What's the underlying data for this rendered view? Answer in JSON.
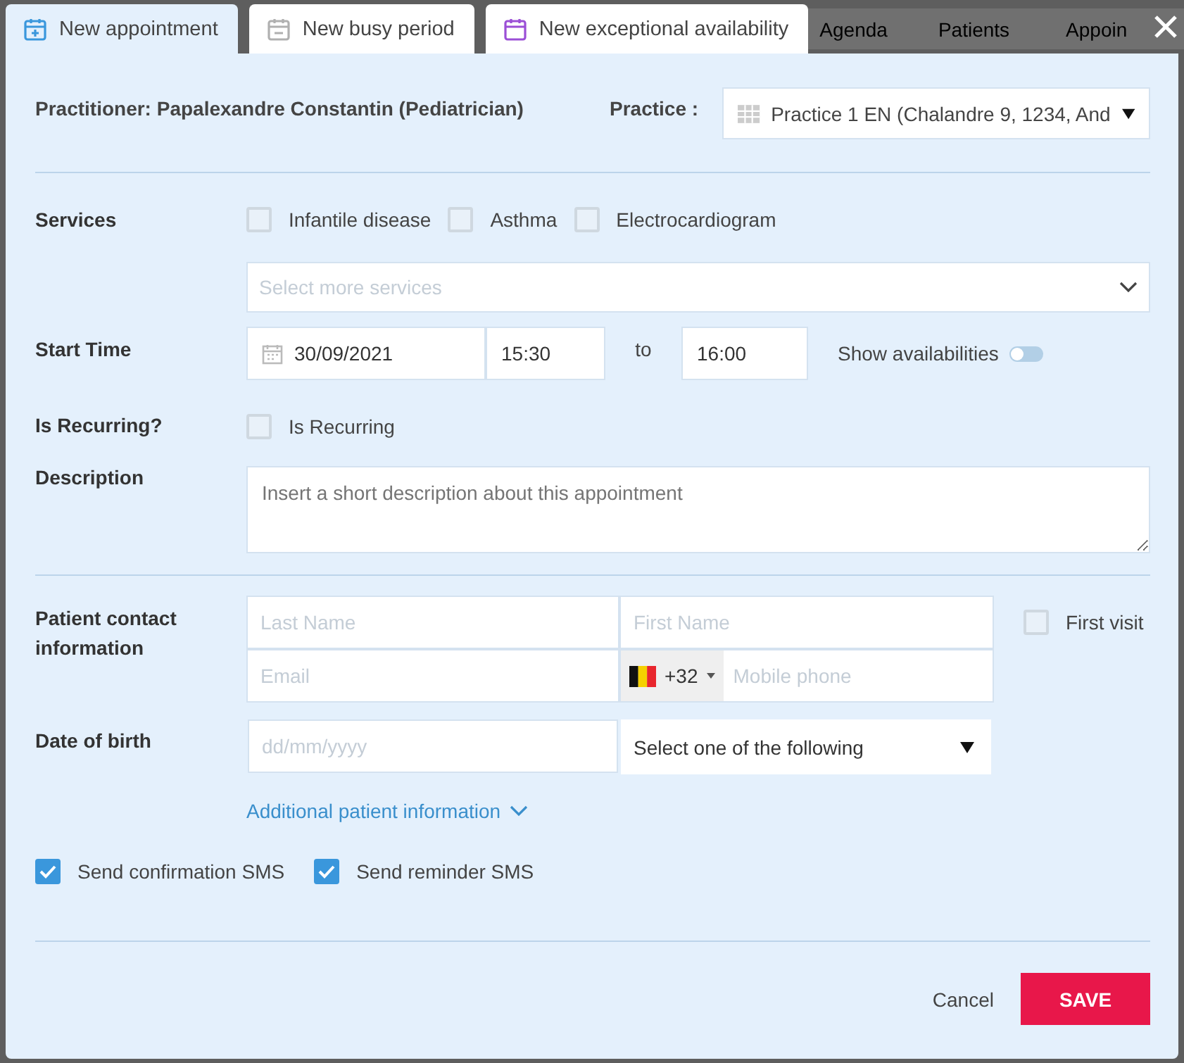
{
  "dialog_tabs": [
    {
      "label": "New appointment",
      "kind": "appointment",
      "selected": true
    },
    {
      "label": "New busy period",
      "kind": "busy",
      "selected": false
    },
    {
      "label": "New exceptional availability",
      "kind": "availability",
      "selected": false
    }
  ],
  "background_tabs": [
    "Agenda",
    "Patients",
    "Appoin"
  ],
  "practitioner": "Practitioner: Papalexandre Constantin (Pediatrician)",
  "practice": {
    "label": "Practice :",
    "value": "Practice 1 EN (Chalandre 9, 1234, And"
  },
  "services": {
    "label": "Services",
    "options": [
      {
        "label": "Infantile disease",
        "checked": false
      },
      {
        "label": "Asthma",
        "checked": false
      },
      {
        "label": "Electrocardiogram",
        "checked": false
      }
    ],
    "more_placeholder": "Select more services"
  },
  "start_time": {
    "label": "Start Time",
    "date": "30/09/2021",
    "from": "15:30",
    "separator": "to",
    "to": "16:00",
    "show_availabilities": {
      "label": "Show availabilities",
      "on": false
    }
  },
  "recurring": {
    "label": "Is Recurring?",
    "option": {
      "label": "Is Recurring",
      "checked": false
    }
  },
  "description": {
    "label": "Description",
    "placeholder": "Insert a short description about this appointment"
  },
  "patient_contact": {
    "label": "Patient contact information",
    "last_name_placeholder": "Last Name",
    "first_name_placeholder": "First Name",
    "email_placeholder": "Email",
    "country_code": "+32",
    "phone_placeholder": "Mobile phone",
    "first_visit": {
      "label": "First visit",
      "checked": false
    }
  },
  "date_of_birth": {
    "label": "Date of birth",
    "placeholder": "dd/mm/yyyy",
    "select": "Select one of the following"
  },
  "additional_link": "Additional patient information",
  "sms_options": [
    {
      "label": "Send confirmation SMS",
      "checked": true
    },
    {
      "label": "Send reminder SMS",
      "checked": true
    }
  ],
  "buttons": {
    "cancel": "Cancel",
    "save": "SAVE"
  }
}
